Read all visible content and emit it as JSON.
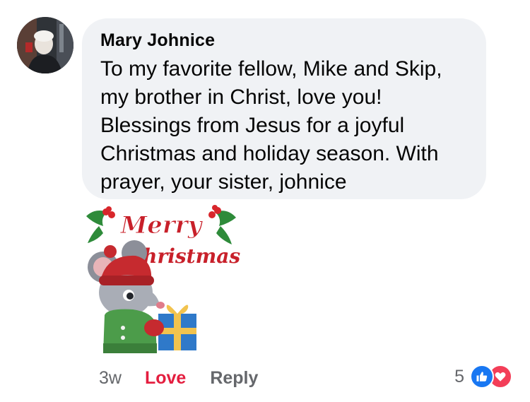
{
  "comment": {
    "author": "Mary Johnice",
    "text": "To my favorite fellow, Mike and Skip, my brother in Christ, love you! Blessings from Jesus for a joyful Christmas and holiday season. With prayer, your sister, johnice",
    "avatar": "profile-photo"
  },
  "sticker": {
    "line1": "Merry",
    "line2": "Christmas",
    "icon": "mouse-with-gift-sticker"
  },
  "actions": {
    "time": "3w",
    "love_label": "Love",
    "reply_label": "Reply"
  },
  "reactions": {
    "count": "5",
    "types": [
      "like-icon",
      "heart-icon"
    ]
  },
  "colors": {
    "bubble": "#f0f2f5",
    "love": "#e41e3f",
    "muted": "#65676b",
    "like": "#1877f2",
    "heart": "#f33e58"
  }
}
